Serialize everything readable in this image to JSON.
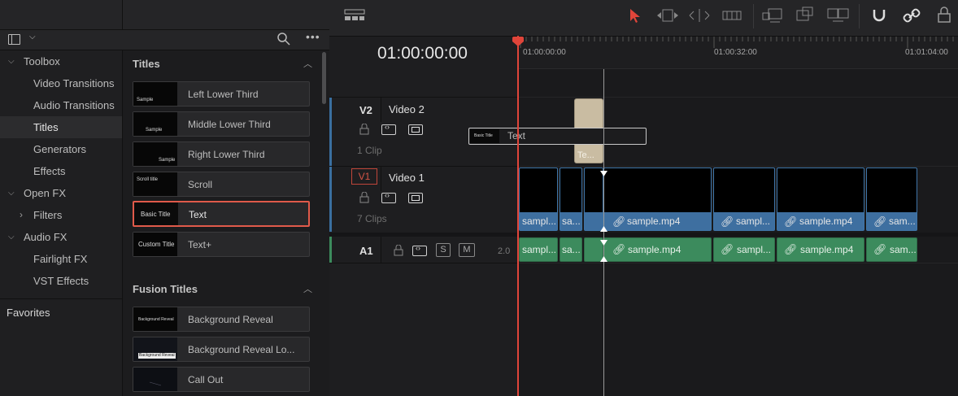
{
  "sidebar": {
    "items": [
      {
        "label": "Toolbox",
        "expanded": true
      },
      {
        "label": "Video Transitions"
      },
      {
        "label": "Audio Transitions"
      },
      {
        "label": "Titles",
        "selected": true
      },
      {
        "label": "Generators"
      },
      {
        "label": "Effects"
      },
      {
        "label": "Open FX",
        "expanded": true
      },
      {
        "label": "Filters",
        "collapsed": true
      },
      {
        "label": "Audio FX",
        "expanded": true
      },
      {
        "label": "Fairlight FX"
      },
      {
        "label": "VST Effects"
      }
    ],
    "favorites": "Favorites"
  },
  "effects": {
    "titles_header": "Titles",
    "titles": [
      {
        "label": "Left Lower Third",
        "thumb": "Sample"
      },
      {
        "label": "Middle Lower Third",
        "thumb": "Sample"
      },
      {
        "label": "Right Lower Third",
        "thumb": "Sample"
      },
      {
        "label": "Scroll",
        "thumb": "Scroll title"
      },
      {
        "label": "Text",
        "thumb": "Basic Title",
        "selected": true
      },
      {
        "label": "Text+",
        "thumb": "Custom Title"
      }
    ],
    "fusion_header": "Fusion Titles",
    "fusion": [
      {
        "label": "Background Reveal",
        "thumb": "Background Reveal"
      },
      {
        "label": "Background Reveal Lo...",
        "thumb": "Background Reveal"
      },
      {
        "label": "Call Out",
        "thumb": ""
      }
    ]
  },
  "timeline": {
    "timecode": "01:00:00:00",
    "ruler": [
      "01:00:00:00",
      "01:00:32:00",
      "01:01:04:00"
    ],
    "tracks": {
      "v2": {
        "id": "V2",
        "name": "Video 2",
        "clips": "1 Clip"
      },
      "v1": {
        "id": "V1",
        "name": "Video 1",
        "clips": "7 Clips"
      },
      "a1": {
        "id": "A1",
        "level": "2.0",
        "solo": "S",
        "mute": "M"
      }
    },
    "drag_ghost": {
      "thumb": "Basic Title",
      "label": "Text"
    },
    "title_clip": "Te...",
    "video_clips": [
      "sampl...",
      "sa...",
      "",
      "sample.mp4",
      "sampl...",
      "sample.mp4",
      "sam..."
    ],
    "audio_clips": [
      "sampl...",
      "sa...",
      "",
      "sample.mp4",
      "sampl...",
      "sample.mp4",
      "sam..."
    ]
  },
  "colors": {
    "accent": "#e05a4a",
    "video_clip": "#3e6fa0",
    "audio_clip": "#3c8b5d",
    "title_clip": "#c9bca2",
    "playhead": "#e0453a"
  }
}
